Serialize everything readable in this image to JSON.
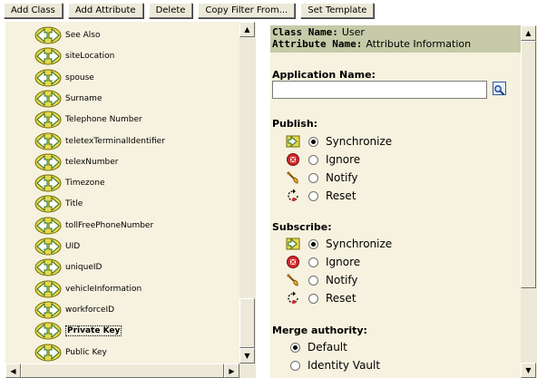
{
  "toolbar": {
    "buttons": [
      "Add Class",
      "Add Attribute",
      "Delete",
      "Copy Filter From...",
      "Set Template"
    ]
  },
  "attribute_list": {
    "items": [
      {
        "label": "See Also",
        "selected": false
      },
      {
        "label": "siteLocation",
        "selected": false
      },
      {
        "label": "spouse",
        "selected": false
      },
      {
        "label": "Surname",
        "selected": false
      },
      {
        "label": "Telephone Number",
        "selected": false
      },
      {
        "label": "teletexTerminalIdentifier",
        "selected": false
      },
      {
        "label": "telexNumber",
        "selected": false
      },
      {
        "label": "Timezone",
        "selected": false
      },
      {
        "label": "Title",
        "selected": false
      },
      {
        "label": "tollFreePhoneNumber",
        "selected": false
      },
      {
        "label": "UID",
        "selected": false
      },
      {
        "label": "uniqueID",
        "selected": false
      },
      {
        "label": "vehicleInformation",
        "selected": false
      },
      {
        "label": "workforceID",
        "selected": false
      },
      {
        "label": "Private Key",
        "selected": true
      },
      {
        "label": "Public Key",
        "selected": false
      }
    ],
    "icon": "sync-arrows-icon",
    "scroll_position": 0.92
  },
  "details": {
    "class_name_label": "Class Name:",
    "class_name_value": "User",
    "attribute_name_label": "Attribute Name:",
    "attribute_name_value": "Attribute Information",
    "application_name_label": "Application Name:",
    "application_name_value": "",
    "publish": {
      "label": "Publish:",
      "options": [
        {
          "label": "Synchronize",
          "icon": "sync-arrow-icon",
          "checked": true
        },
        {
          "label": "Ignore",
          "icon": "ignore-icon",
          "checked": false
        },
        {
          "label": "Notify",
          "icon": "notify-bell-icon",
          "checked": false
        },
        {
          "label": "Reset",
          "icon": "reset-icon",
          "checked": false
        }
      ]
    },
    "subscribe": {
      "label": "Subscribe:",
      "options": [
        {
          "label": "Synchronize",
          "icon": "sync-arrow-icon",
          "checked": true
        },
        {
          "label": "Ignore",
          "icon": "ignore-icon",
          "checked": false
        },
        {
          "label": "Notify",
          "icon": "notify-bell-icon",
          "checked": false
        },
        {
          "label": "Reset",
          "icon": "reset-icon",
          "checked": false
        }
      ]
    },
    "merge_authority": {
      "label": "Merge authority:",
      "options": [
        {
          "label": "Default",
          "checked": true
        },
        {
          "label": "Identity Vault",
          "checked": false
        }
      ]
    }
  },
  "colors": {
    "panel_bg": "#f6f2df",
    "header_band": "#c6caa8",
    "icon_yellow": "#e8d84a",
    "icon_green": "#3a8a2a"
  }
}
